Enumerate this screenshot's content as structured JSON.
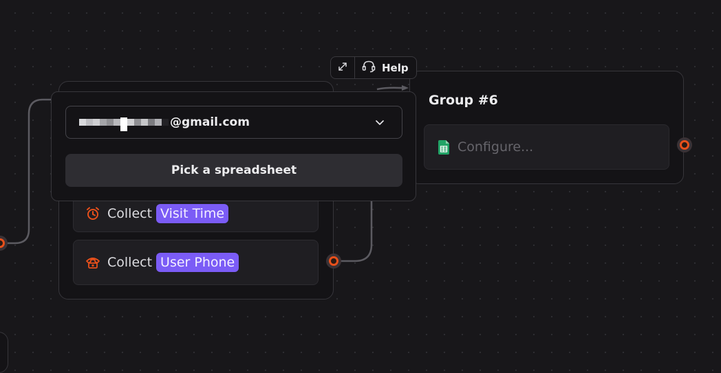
{
  "toolbar": {
    "expand_icon": "expand-arrows-icon",
    "help_icon": "headset-icon",
    "help_label": "Help"
  },
  "popover": {
    "account_email_suffix": "@gmail.com",
    "account_email_redacted": true,
    "dropdown_icon": "chevron-down-icon",
    "pick_button_label": "Pick a spreadsheet"
  },
  "left_group": {
    "blocks": [
      {
        "icon": "alarm-clock-icon",
        "label": "Collect",
        "variable": "Visit Time"
      },
      {
        "icon": "phone-icon",
        "label": "Collect",
        "variable": "User Phone"
      }
    ]
  },
  "group6": {
    "title": "Group #6",
    "block": {
      "icon": "google-sheets-icon",
      "placeholder": "Configure..."
    }
  },
  "colors": {
    "canvas": "#18171a",
    "card": "#141316",
    "block": "#1f1e22",
    "variable_tag": "#7b5cf6",
    "accent_orange": "#e8501b",
    "sheets_green": "#21a366"
  }
}
